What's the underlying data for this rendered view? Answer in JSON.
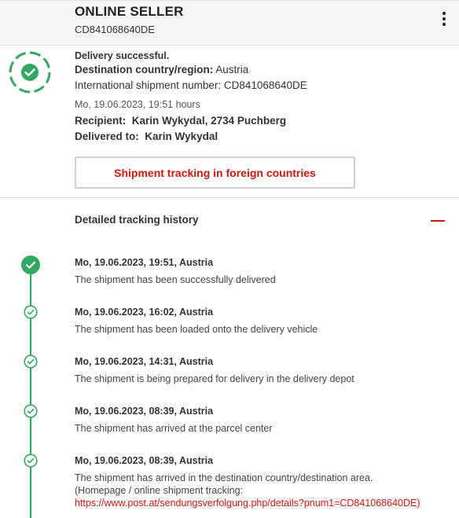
{
  "header": {
    "sender": "ONLINE SELLER",
    "tracking_number": "CD841068640DE"
  },
  "summary": {
    "status": "Delivery successful.",
    "destination_label": "Destination country/region:",
    "destination_value": "Austria",
    "intl_label": "International shipment number:",
    "intl_value": "CD841068640DE",
    "datetime": "Mo, 19.06.2023, 19:51 hours",
    "recipient_label": "Recipient:",
    "recipient_value": "Karin Wykydal, 2734 Puchberg",
    "delivered_to_label": "Delivered to:",
    "delivered_to_value": "Karin Wykydal"
  },
  "foreign_tracking_button": "Shipment tracking in foreign countries",
  "history": {
    "title": "Detailed tracking history",
    "events": [
      {
        "title": "Mo, 19.06.2023, 19:51, Austria",
        "text": "The shipment has been successfully delivered"
      },
      {
        "title": "Mo, 19.06.2023, 16:02, Austria",
        "text": "The shipment has been loaded onto the delivery vehicle"
      },
      {
        "title": "Mo, 19.06.2023, 14:31, Austria",
        "text": "The shipment is being prepared for delivery in the delivery depot"
      },
      {
        "title": "Mo, 19.06.2023, 08:39, Austria",
        "text": "The shipment has arrived at the parcel center"
      },
      {
        "title": "Mo, 19.06.2023, 08:39, Austria",
        "text": "The shipment has arrived in the destination country/destination area.",
        "text2": "(Homepage / online shipment tracking:",
        "link": "https://www.post.at/sendungsverfolgung.php/details?pnum1=CD841068640DE)"
      }
    ]
  },
  "colors": {
    "accent_red": "#d6150f",
    "success_green": "#33a862"
  },
  "icons": {
    "status": "check-circle-icon",
    "menu": "more-vertical-icon",
    "collapse": "minus-icon",
    "event_done": "check-circle-icon"
  }
}
